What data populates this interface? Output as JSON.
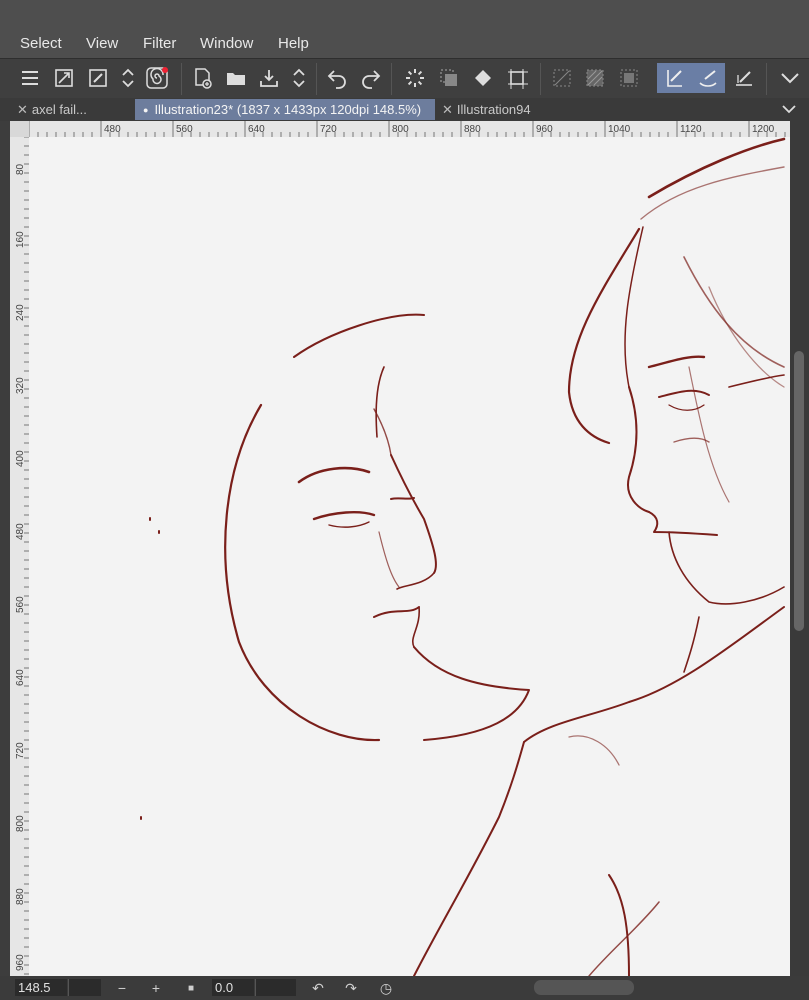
{
  "menu": [
    "Select",
    "View",
    "Filter",
    "Window",
    "Help"
  ],
  "tabs": [
    {
      "label": "axel fail..."
    },
    {
      "label": "Illustration23* (1837 x 1433px 120dpi 148.5%)"
    },
    {
      "label": "Illustration94"
    }
  ],
  "ruler": {
    "h_ticks": [
      "480",
      "560",
      "640",
      "720",
      "800",
      "880",
      "960",
      "1040",
      "1120",
      "1200"
    ],
    "v_ticks": [
      "80",
      "160",
      "240",
      "320",
      "400",
      "480",
      "560",
      "640",
      "720",
      "800",
      "880",
      "960"
    ]
  },
  "status": {
    "zoom": "148.5",
    "rotation": "0.0"
  },
  "colors": {
    "stroke": "#7a1f1a",
    "accent": "#6a7ea5"
  }
}
